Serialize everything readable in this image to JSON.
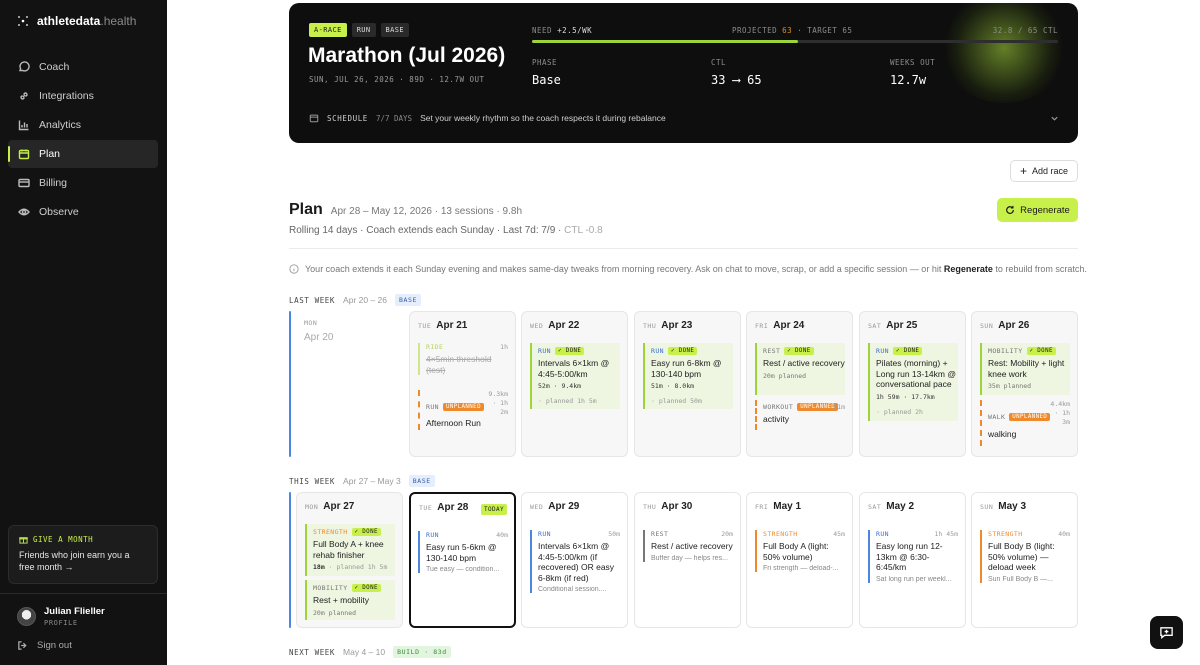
{
  "sidebar": {
    "brand": "athletedata",
    "brand_suffix": ".health",
    "nav": [
      {
        "label": "Coach",
        "icon": "chat-icon"
      },
      {
        "label": "Integrations",
        "icon": "link-icon"
      },
      {
        "label": "Analytics",
        "icon": "chart-icon"
      },
      {
        "label": "Plan",
        "icon": "calendar-icon",
        "active": true
      },
      {
        "label": "Billing",
        "icon": "card-icon"
      },
      {
        "label": "Observe",
        "icon": "eye-icon"
      }
    ],
    "promo": {
      "tag": "GIVE A MONTH",
      "text": "Friends who join earn you a free month →"
    },
    "user": {
      "name": "Julian Flieller",
      "subtitle": "PROFILE"
    },
    "signout": "Sign out"
  },
  "hero": {
    "badges": [
      "A-RACE",
      "RUN",
      "BASE"
    ],
    "title": "Marathon (Jul 2026)",
    "subtitle": "SUN, JUL 26, 2026 · 89D · 12.7W OUT",
    "need_label": "NEED",
    "need_value": "+2.5/WK",
    "projected_label": "PROJECTED",
    "projected_value": "63",
    "target_text": "· TARGET 65",
    "ctl_readout": "32.8 / 65 CTL",
    "progress": 0.505,
    "phase_label": "PHASE",
    "phase_value": "Base",
    "ctl_label": "CTL",
    "ctl_value": "33 ⟶ 65",
    "weeks_label": "WEEKS OUT",
    "weeks_value": "12.7w",
    "schedule_label": "SCHEDULE",
    "schedule_days": "7/7 DAYS",
    "schedule_text": "Set your weekly rhythm so the coach respects it during rebalance"
  },
  "add_race": "Add race",
  "plan": {
    "title": "Plan",
    "range": "Apr 28 – May 12, 2026 · 13 sessions · 9.8h",
    "sub": "Rolling 14 days · Coach extends each Sunday · Last 7d: 7/9 ·",
    "sub_ctl": "CTL -0.8",
    "regenerate": "Regenerate",
    "info_pre": "Your coach extends it each Sunday evening and makes same-day tweaks from morning recovery. Ask on chat to move, scrap, or add a specific session — or hit",
    "info_bold": "Regenerate",
    "info_post": "to rebuild from scratch."
  },
  "last_week": {
    "label": "LAST WEEK",
    "range": "Apr 20 – 26",
    "phase": "BASE",
    "days": [
      {
        "dow": "MON",
        "date": "Apr 20"
      },
      {
        "dow": "TUE",
        "date": "Apr 21"
      },
      {
        "dow": "WED",
        "date": "Apr 22"
      },
      {
        "dow": "THU",
        "date": "Apr 23"
      },
      {
        "dow": "FRI",
        "date": "Apr 24"
      },
      {
        "dow": "SAT",
        "date": "Apr 25"
      },
      {
        "dow": "SUN",
        "date": "Apr 26"
      }
    ],
    "s": {
      "tue_ride": {
        "type": "RIDE",
        "dur": "1h",
        "name": "4×5min threshold (test)"
      },
      "tue_run": {
        "type": "RUN",
        "flag": "UNPLANNED",
        "dur": "9.3km · 1h 2m",
        "name": "Afternoon Run"
      },
      "wed": {
        "type": "RUN",
        "flag": "DONE",
        "name": "Intervals 6×1km @ 4:45-5:00/km",
        "metrics": "52m · 9.4km",
        "planned": "· planned 1h 5m"
      },
      "thu": {
        "type": "RUN",
        "flag": "DONE",
        "name": "Easy run 6-8km @ 130-140 bpm",
        "metrics": "51m · 8.0km",
        "planned": "· planned 50m"
      },
      "fri_rest": {
        "type": "REST",
        "flag": "DONE",
        "name": "Rest / active recovery",
        "planned": "20m planned"
      },
      "fri_wo": {
        "type": "WORKOUT",
        "flag": "UNPLANNED",
        "dur": "51m",
        "name": "activity"
      },
      "sat": {
        "type": "RUN",
        "flag": "DONE",
        "name": "Pilates (morning) + Long run 13-14km @ conversational pace",
        "metrics": "1h 59m · 17.7km",
        "planned": "· planned 2h"
      },
      "sun_mob": {
        "type": "MOBILITY",
        "flag": "DONE",
        "name": "Rest: Mobility + light knee work",
        "planned": "35m planned"
      },
      "sun_walk": {
        "type": "WALK",
        "flag": "UNPLANNED",
        "dur": "4.4km · 1h 3m",
        "name": "walking"
      }
    }
  },
  "this_week": {
    "label": "THIS WEEK",
    "range": "Apr 27 – May 3",
    "phase": "BASE",
    "today": "TODAY",
    "days": [
      {
        "dow": "MON",
        "date": "Apr 27"
      },
      {
        "dow": "TUE",
        "date": "Apr 28"
      },
      {
        "dow": "WED",
        "date": "Apr 29"
      },
      {
        "dow": "THU",
        "date": "Apr 30"
      },
      {
        "dow": "FRI",
        "date": "May 1"
      },
      {
        "dow": "SAT",
        "date": "May 2"
      },
      {
        "dow": "SUN",
        "date": "May 3"
      }
    ],
    "s": {
      "mon_str": {
        "type": "STRENGTH",
        "flag": "DONE",
        "name": "Full Body A + knee rehab finisher",
        "metrics": "18m",
        "planned": "· planned 1h 5m"
      },
      "mon_mob": {
        "type": "MOBILITY",
        "flag": "DONE",
        "name": "Rest + mobility",
        "planned": "20m planned"
      },
      "tue": {
        "type": "RUN",
        "dur": "40m",
        "name": "Easy run 5-6km @ 130-140 bpm",
        "desc": "Tue easy — condition..."
      },
      "wed": {
        "type": "RUN",
        "dur": "50m",
        "name": "Intervals 6×1km @ 4:45-5:00/km (if recovered) OR easy 6-8km (if red)",
        "desc": "Conditional session...."
      },
      "thu": {
        "type": "REST",
        "dur": "20m",
        "name": "Rest / active recovery",
        "desc": "Buffer day — helps res..."
      },
      "fri": {
        "type": "STRENGTH",
        "dur": "45m",
        "name": "Full Body A (light: 50% volume)",
        "desc": "Fri strength — deload-..."
      },
      "sat": {
        "type": "RUN",
        "dur": "1h 45m",
        "name": "Easy long run 12-13km @ 6:30-6:45/km",
        "desc": "Sat long run per weekl..."
      },
      "sun": {
        "type": "STRENGTH",
        "dur": "40m",
        "name": "Full Body B (light: 50% volume) — deload week",
        "desc": "Sun Full Body B —..."
      }
    }
  },
  "next_week": {
    "label": "NEXT WEEK",
    "range": "May 4 – 10",
    "phase": "BUILD · 83d"
  },
  "colors": {
    "accent": "#c8f04a",
    "run": "#4b86e0",
    "strength": "#ef8a2c",
    "unplanned": "#ef8a2c"
  }
}
